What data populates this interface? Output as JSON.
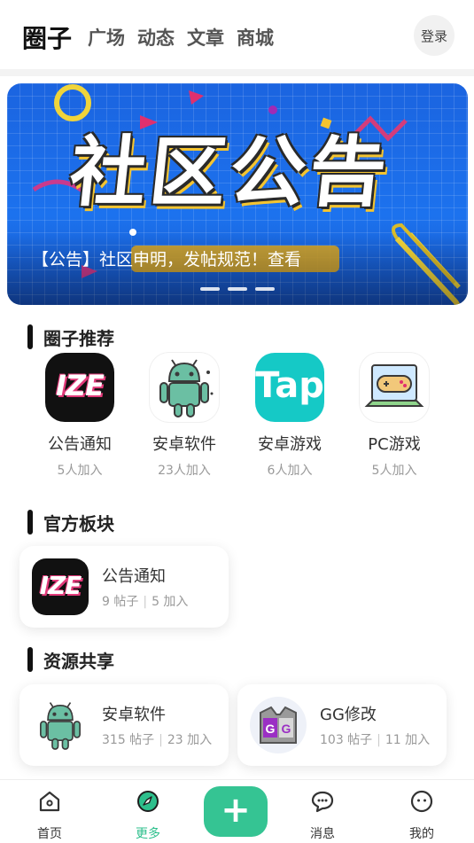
{
  "header": {
    "logo": "圈子",
    "nav": [
      "广场",
      "动态",
      "文章",
      "商城"
    ],
    "login_label": "登录"
  },
  "banner": {
    "big_text": "社区公告",
    "caption": "【公告】社区申明，发帖规范！查看",
    "slide_count": 3
  },
  "recommend": {
    "title": "圈子推荐",
    "items": [
      {
        "name": "公告通知",
        "count": "5人加入",
        "icon": "lze-logo-icon"
      },
      {
        "name": "安卓软件",
        "count": "23人加入",
        "icon": "android-icon"
      },
      {
        "name": "安卓游戏",
        "count": "6人加入",
        "icon": "taptap-icon"
      },
      {
        "name": "PC游戏",
        "count": "5人加入",
        "icon": "pc-gamepad-icon"
      }
    ]
  },
  "official": {
    "title": "官方板块",
    "cards": [
      {
        "name": "公告通知",
        "posts": "9 帖子",
        "joined": "5 加入",
        "icon": "lze-logo-icon"
      }
    ]
  },
  "resources": {
    "title": "资源共享",
    "cards": [
      {
        "name": "安卓软件",
        "posts": "315 帖子",
        "joined": "23 加入",
        "icon": "android-icon"
      },
      {
        "name": "GG修改",
        "posts": "103 帖子",
        "joined": "11 加入",
        "icon": "gg-icon"
      }
    ]
  },
  "bottom_nav": {
    "home": "首页",
    "more": "更多",
    "messages": "消息",
    "mine": "我的",
    "active": "more"
  },
  "colors": {
    "accent": "#35c493",
    "active_tab": "#2dbf8c",
    "tap_icon": "#15c9c6",
    "banner_blue": "#1c72ee"
  }
}
